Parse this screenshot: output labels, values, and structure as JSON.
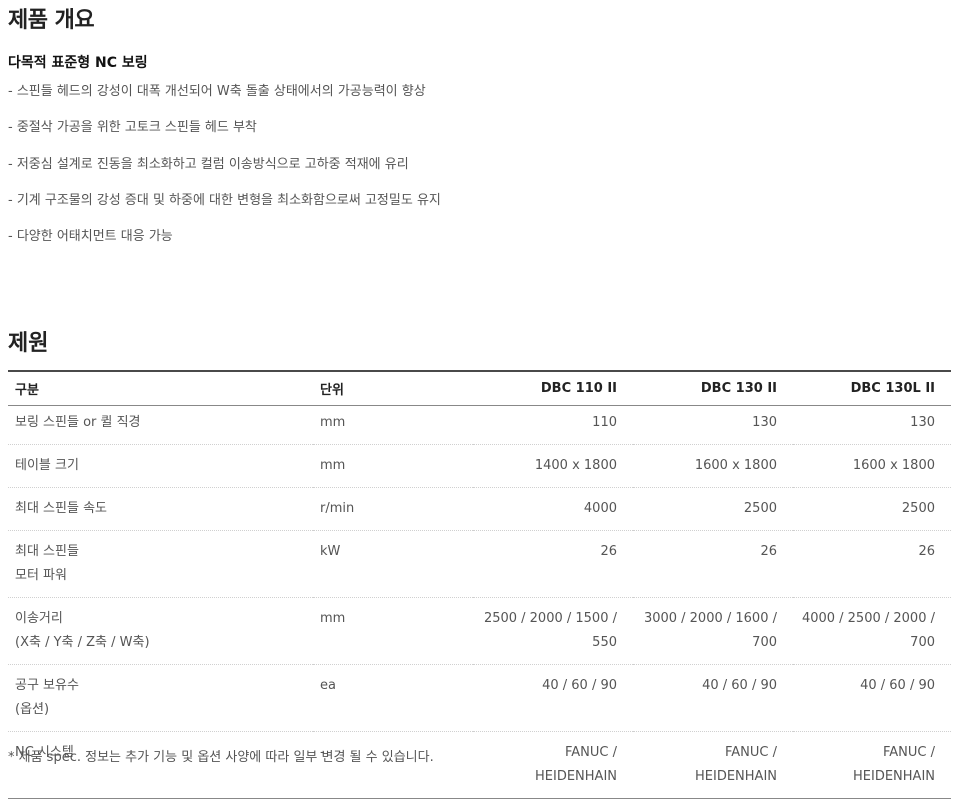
{
  "overview": {
    "title": "제품 개요",
    "subtitle": "다목적 표준형 NC 보링",
    "features": [
      "- 스핀들 헤드의 강성이 대폭 개선되어 W축 돌출 상태에서의 가공능력이 향상",
      "- 중절삭 가공을 위한 고토크 스핀들 헤드 부착",
      "- 저중심 설계로 진동을 최소화하고 컬럼 이송방식으로 고하중 적재에 유리",
      "- 기계 구조물의 강성 증대 및 하중에 대한 변형을 최소화함으로써 고정밀도 유지",
      "- 다양한 어태치먼트 대응 가능"
    ]
  },
  "specs": {
    "title": "제원",
    "headers": [
      "구분",
      "단위",
      "DBC 110 II",
      "DBC 130 II",
      "DBC 130L II"
    ],
    "rows": [
      {
        "name": "보링 스핀들 or 퀼 직경",
        "unit": "mm",
        "v1": "110",
        "v2": "130",
        "v3": "130"
      },
      {
        "name": "테이블 크기",
        "unit": "mm",
        "v1": "1400 x 1800",
        "v2": "1600 x 1800",
        "v3": "1600 x 1800"
      },
      {
        "name": "최대 스핀들 속도",
        "unit": "r/min",
        "v1": "4000",
        "v2": "2500",
        "v3": "2500"
      },
      {
        "name": "최대 스핀들\n모터 파워",
        "unit": "kW",
        "v1": "26",
        "v2": "26",
        "v3": "26"
      },
      {
        "name": "이송거리\n(X축 / Y축 / Z축 / W축)",
        "unit": "mm",
        "v1": "2500 / 2000 / 1500 /\n550",
        "v2": "3000 / 2000 / 1600 /\n700",
        "v3": "4000 / 2500 / 2000 /\n700"
      },
      {
        "name": "공구 보유수\n(옵션)",
        "unit": "ea",
        "v1": "40 / 60 / 90",
        "v2": "40 / 60 / 90",
        "v3": "40 / 60 / 90"
      },
      {
        "name": "NC 시스템",
        "unit": "-",
        "v1": "FANUC / HEIDENHAIN",
        "v2": "FANUC / HEIDENHAIN",
        "v3": "FANUC / HEIDENHAIN"
      }
    ],
    "note": "* 제품 spec. 정보는 추가 기능 및 옵션 사양에 따라 일부 변경 될 수 있습니다."
  }
}
